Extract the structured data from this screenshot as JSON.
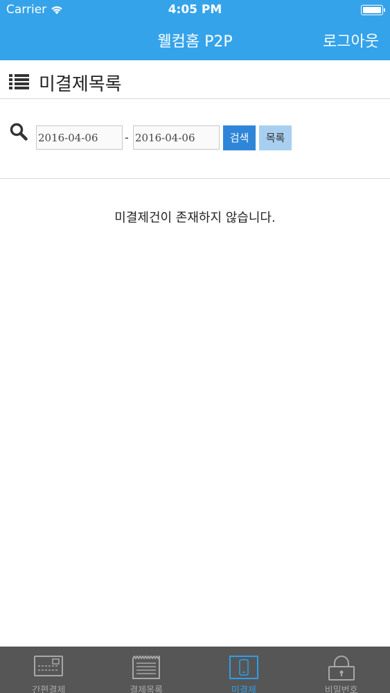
{
  "status_bar": {
    "carrier": "Carrier",
    "time": "4:05 PM"
  },
  "nav": {
    "title": "웰컴홈 P2P",
    "logout_label": "로그아웃"
  },
  "section": {
    "title": "미결제목록"
  },
  "search": {
    "date_from": "2016-04-06",
    "date_separator": "-",
    "date_to": "2016-04-06",
    "search_label": "검색",
    "list_label": "목록"
  },
  "empty_message": "미결제건이 존재하지 않습니다.",
  "tabs": [
    {
      "label": "간편결제",
      "icon": "card-reader-icon",
      "active": false
    },
    {
      "label": "결제목록",
      "icon": "receipt-icon",
      "active": false
    },
    {
      "label": "미결제",
      "icon": "phone-icon",
      "active": true
    },
    {
      "label": "비밀번호",
      "icon": "lock-icon",
      "active": false
    }
  ],
  "colors": {
    "header": "#35a3ea",
    "search_button": "#2f86d8",
    "list_button": "#a9cff0",
    "tabbar": "#565657",
    "tab_active": "#2f9ee8"
  }
}
